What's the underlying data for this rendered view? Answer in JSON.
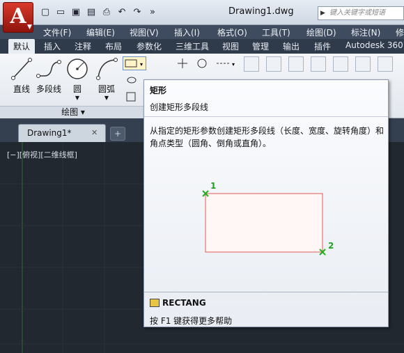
{
  "titlebar": {
    "app_logo": "A",
    "doc_title": "Drawing1.dwg",
    "search_placeholder": "键入关键字或短语",
    "quick_access_icons": [
      "new-icon",
      "open-icon",
      "save-icon",
      "save-as-icon",
      "print-icon",
      "undo-icon",
      "redo-icon",
      "more-icon"
    ]
  },
  "menu": {
    "items": [
      "文件(F)",
      "编辑(E)",
      "视图(V)",
      "插入(I)",
      "格式(O)",
      "工具(T)",
      "绘图(D)",
      "标注(N)",
      "修"
    ]
  },
  "ribbon_tabs": [
    "默认",
    "插入",
    "注释",
    "布局",
    "参数化",
    "三维工具",
    "视图",
    "管理",
    "输出",
    "插件",
    "Autodesk 360"
  ],
  "ribbon": {
    "tools": [
      "直线",
      "多段线",
      "圆",
      "圆弧"
    ],
    "panel_label": "绘图 ▾"
  },
  "doc_tabs": {
    "active": "Drawing1*",
    "close": "✕"
  },
  "viewport_label": "[−][俯视][二维线框]",
  "tooltip": {
    "title": "矩形",
    "subtitle": "创建矩形多段线",
    "description": "从指定的矩形参数创建矩形多段线（长度、宽度、旋转角度）和角点类型（圆角、倒角或直角）。",
    "point1": "1",
    "point2": "2",
    "command": "RECTANG",
    "help": "按 F1 键获得更多帮助"
  },
  "colors": {
    "accent_red": "#c8261a",
    "canvas": "#212830",
    "marker_green": "#22b022",
    "rect_outline": "#e05a55"
  }
}
